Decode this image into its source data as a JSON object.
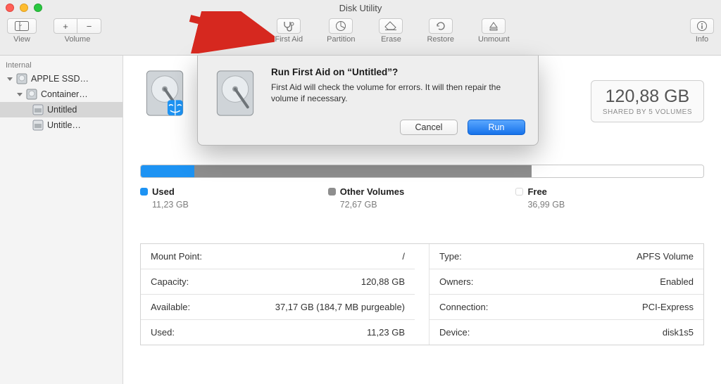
{
  "window": {
    "title": "Disk Utility"
  },
  "toolbar": {
    "view_label": "View",
    "volume_label": "Volume",
    "firstaid_label": "First Aid",
    "partition_label": "Partition",
    "erase_label": "Erase",
    "restore_label": "Restore",
    "unmount_label": "Unmount",
    "info_label": "Info",
    "plus_glyph": "+",
    "minus_glyph": "−"
  },
  "sidebar": {
    "section": "Internal",
    "items": {
      "disk": {
        "label": "APPLE SSD…"
      },
      "container": {
        "label": "Container…"
      },
      "vol0": {
        "label": "Untitled"
      },
      "vol1": {
        "label": "Untitle…"
      }
    }
  },
  "capacity": {
    "value": "120,88 GB",
    "subtitle": "SHARED BY 5 VOLUMES"
  },
  "usage": {
    "used_label": "Used",
    "used_value": "11,23 GB",
    "other_label": "Other Volumes",
    "other_value": "72,67 GB",
    "free_label": "Free",
    "free_value": "36,99 GB"
  },
  "info": {
    "left": {
      "mount_label": "Mount Point:",
      "mount_value": "/",
      "cap_label": "Capacity:",
      "cap_value": "120,88 GB",
      "avail_label": "Available:",
      "avail_value": "37,17 GB (184,7 MB purgeable)",
      "used_label": "Used:",
      "used_value": "11,23 GB"
    },
    "right": {
      "type_label": "Type:",
      "type_value": "APFS Volume",
      "owners_label": "Owners:",
      "owners_value": "Enabled",
      "conn_label": "Connection:",
      "conn_value": "PCI-Express",
      "dev_label": "Device:",
      "dev_value": "disk1s5"
    }
  },
  "dialog": {
    "title": "Run First Aid on “Untitled”?",
    "message": "First Aid will check the volume for errors. It will then repair the volume if necessary.",
    "cancel": "Cancel",
    "run": "Run"
  }
}
